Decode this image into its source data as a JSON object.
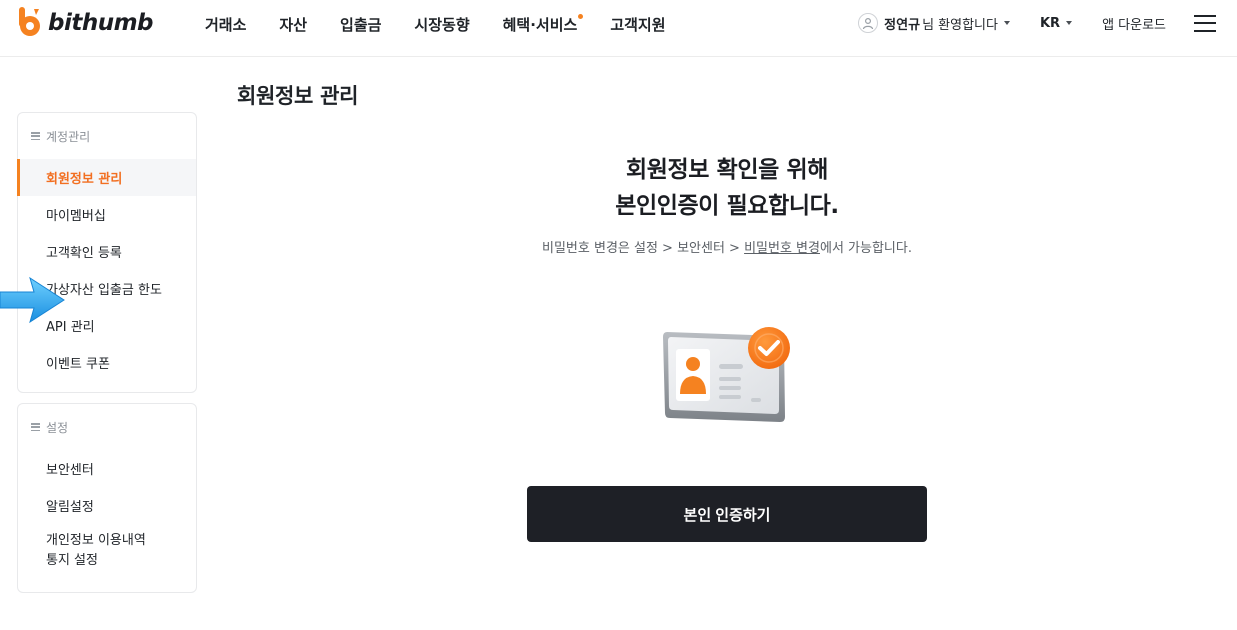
{
  "brand": {
    "name": "bithumb",
    "accent": "#f58220"
  },
  "nav": {
    "items": [
      {
        "label": "거래소"
      },
      {
        "label": "자산"
      },
      {
        "label": "입출금"
      },
      {
        "label": "시장동향"
      },
      {
        "label": "혜택·서비스",
        "has_dot": true
      },
      {
        "label": "고객지원"
      }
    ]
  },
  "header": {
    "user_name": "정연규",
    "user_greeting": "님 환영합니다",
    "language": "KR",
    "download": "앱 다운로드"
  },
  "sidebar": {
    "account": {
      "title": "계정관리",
      "items": [
        {
          "label": "회원정보 관리",
          "active": true
        },
        {
          "label": "마이멤버십"
        },
        {
          "label": "고객확인 등록"
        },
        {
          "label": "가상자산 입출금 한도"
        },
        {
          "label": "API 관리"
        },
        {
          "label": "이벤트 쿠폰"
        }
      ]
    },
    "settings": {
      "title": "설정",
      "items": [
        {
          "label": "보안센터"
        },
        {
          "label": "알림설정"
        },
        {
          "label": "개인정보 이용내역",
          "label2": "통지 설정"
        }
      ]
    }
  },
  "main": {
    "page_title": "회원정보 관리",
    "verify_title_line1": "회원정보 확인을 위해",
    "verify_title_line2": "본인인증이 필요합니다.",
    "sub_prefix": "비밀번호 변경은 설정 > 보안센터 > ",
    "sub_link": "비밀번호 변경",
    "sub_suffix": "에서 가능합니다.",
    "verify_button": "본인 인증하기"
  },
  "icons": {
    "logo": "bithumb-logo-icon",
    "user": "user-avatar-icon",
    "menu": "hamburger-icon",
    "illustration": "id-card-check-icon",
    "pointer": "arrow-pointer-icon"
  }
}
